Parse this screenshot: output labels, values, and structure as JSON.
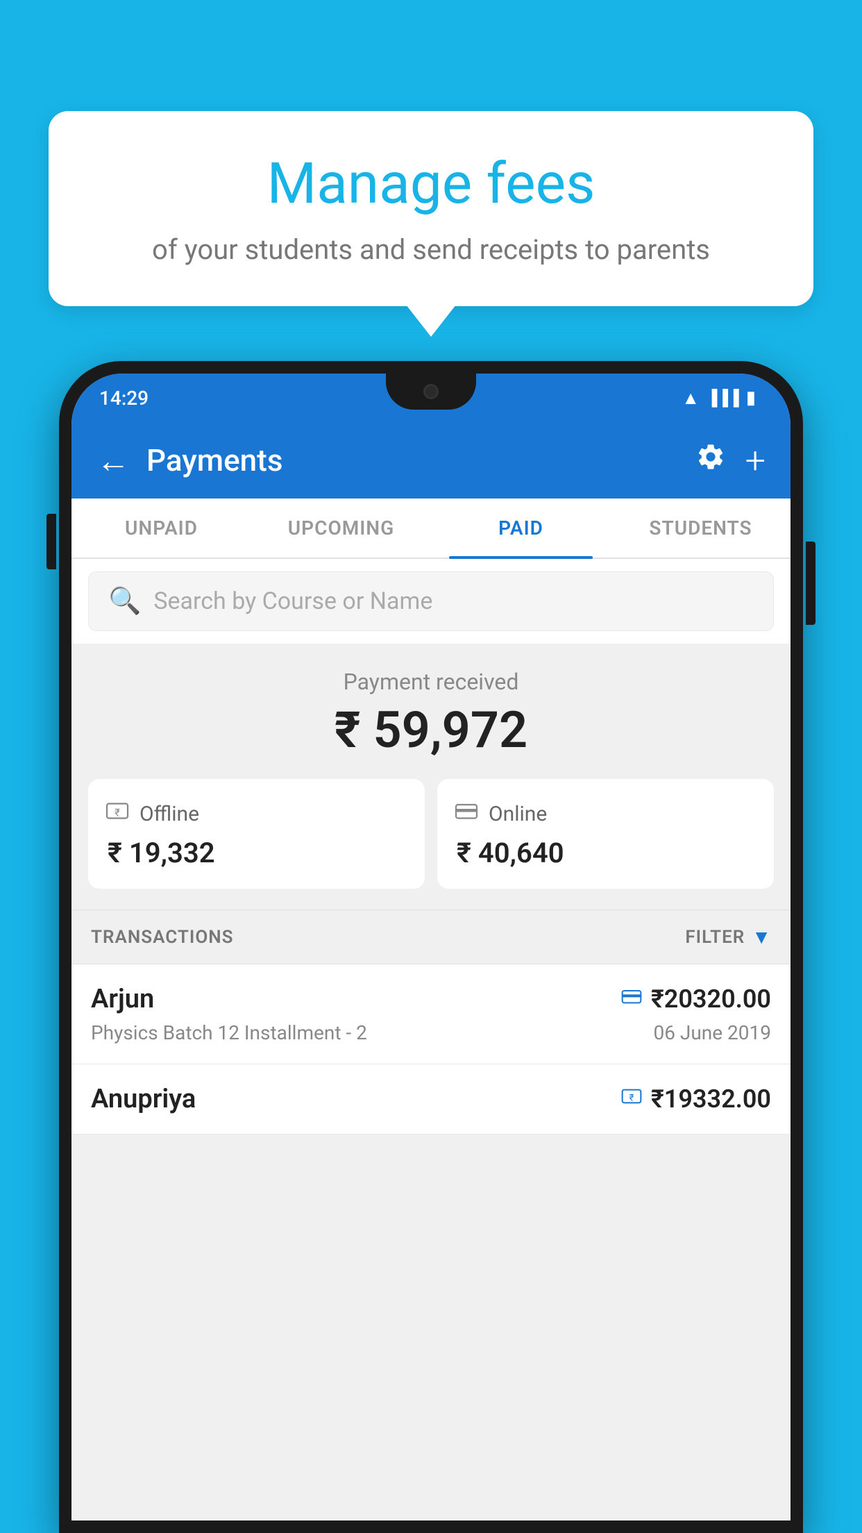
{
  "page": {
    "background_color": "#18b4e8"
  },
  "speech_bubble": {
    "title": "Manage fees",
    "subtitle": "of your students and send receipts to parents"
  },
  "status_bar": {
    "time": "14:29",
    "wifi_icon": "wifi",
    "signal_icon": "signal",
    "battery_icon": "battery"
  },
  "app_bar": {
    "title": "Payments",
    "back_label": "←",
    "settings_label": "⚙",
    "add_label": "+"
  },
  "tabs": [
    {
      "label": "UNPAID",
      "active": false
    },
    {
      "label": "UPCOMING",
      "active": false
    },
    {
      "label": "PAID",
      "active": true
    },
    {
      "label": "STUDENTS",
      "active": false
    }
  ],
  "search": {
    "placeholder": "Search by Course or Name"
  },
  "payment_summary": {
    "label": "Payment received",
    "total": "₹ 59,972",
    "offline": {
      "label": "Offline",
      "amount": "₹ 19,332"
    },
    "online": {
      "label": "Online",
      "amount": "₹ 40,640"
    }
  },
  "transactions": {
    "header_label": "TRANSACTIONS",
    "filter_label": "FILTER",
    "items": [
      {
        "name": "Arjun",
        "detail": "Physics Batch 12 Installment - 2",
        "amount": "₹20320.00",
        "date": "06 June 2019",
        "payment_type": "card"
      },
      {
        "name": "Anupriya",
        "detail": "",
        "amount": "₹19332.00",
        "date": "",
        "payment_type": "offline"
      }
    ]
  }
}
